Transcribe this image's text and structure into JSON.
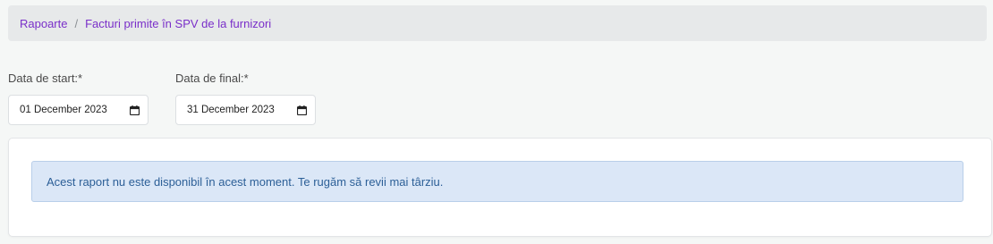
{
  "breadcrumb": {
    "root_label": "Rapoarte",
    "separator": "/",
    "current_label": "Facturi primite în SPV de la furnizori"
  },
  "filters": {
    "start": {
      "label": "Data de start:*",
      "value": "01 December 2023",
      "icon": "calendar-icon"
    },
    "end": {
      "label": "Data de final:*",
      "value": "31 December 2023",
      "icon": "calendar-icon"
    }
  },
  "report": {
    "message": "Acest raport nu este disponibil în acest moment. Te rugăm să revii mai târziu."
  },
  "colors": {
    "accent": "#7a2fc9",
    "alert_bg": "#dbe7f7",
    "alert_text": "#2c5f97",
    "page_bg": "#f5f7f6"
  }
}
